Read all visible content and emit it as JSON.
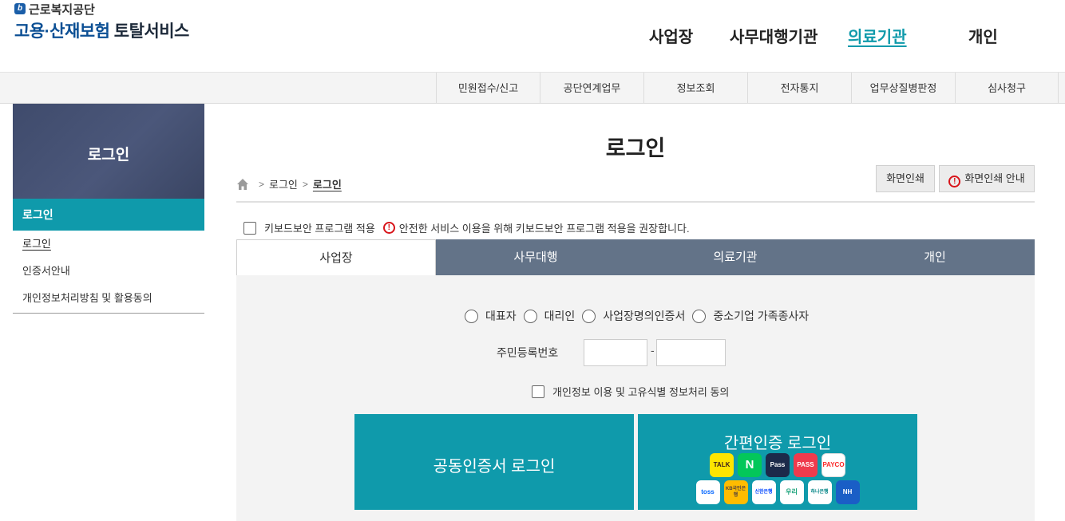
{
  "header": {
    "org_name": "근로복지공단",
    "service_title_blue": "고용·산재보험",
    "service_title_dark": "토탈서비스",
    "nav": [
      "사업장",
      "사무대행기관",
      "의료기관",
      "개인"
    ]
  },
  "subnav": [
    "민원접수/신고",
    "공단연계업무",
    "정보조회",
    "전자통지",
    "업무상질병판정",
    "심사청구"
  ],
  "sidebar": {
    "banner_title": "로그인",
    "menu_heading": "로그인",
    "items": [
      "로그인",
      "인증서안내",
      "개인정보처리방침 및 활용동의"
    ]
  },
  "main": {
    "page_title": "로그인",
    "breadcrumb": [
      "로그인",
      "로그인"
    ],
    "print_label": "화면인쇄",
    "print_guide_label": "화면인쇄 안내",
    "keyboard_security_label": "키보드보안 프로그램 적용",
    "keyboard_security_notice": "안전한 서비스 이용을 위해 키보드보안 프로그램 적용을 권장합니다.",
    "tabs": [
      "사업장",
      "사무대행",
      "의료기관",
      "개인"
    ],
    "radio_options": [
      "대표자",
      "대리인",
      "사업장명의인증서",
      "중소기업 가족종사자"
    ],
    "rrn_label": "주민등록번호",
    "rrn_dash": "-",
    "rrn_front_value": "",
    "rrn_back_value": "",
    "consent_label": "개인정보 이용 및 고유식별 정보처리 동의",
    "joint_cert_login": "공동인증서 로그인",
    "simple_auth_login": "간편인증 로그인",
    "simple_auth_apps_row1": [
      "TALK",
      "N",
      "Pass",
      "PASS",
      "PAYCO"
    ],
    "simple_auth_apps_row2": [
      "toss",
      "KB국민은행",
      "신한은행",
      "우리",
      "하나은행",
      "NH"
    ]
  },
  "colors": {
    "accent_teal": "#0f9aab",
    "tab_gray": "#637388",
    "banner_navy": "#46527a",
    "brand_blue": "#0b4f94",
    "alert_red": "#d8141a"
  }
}
